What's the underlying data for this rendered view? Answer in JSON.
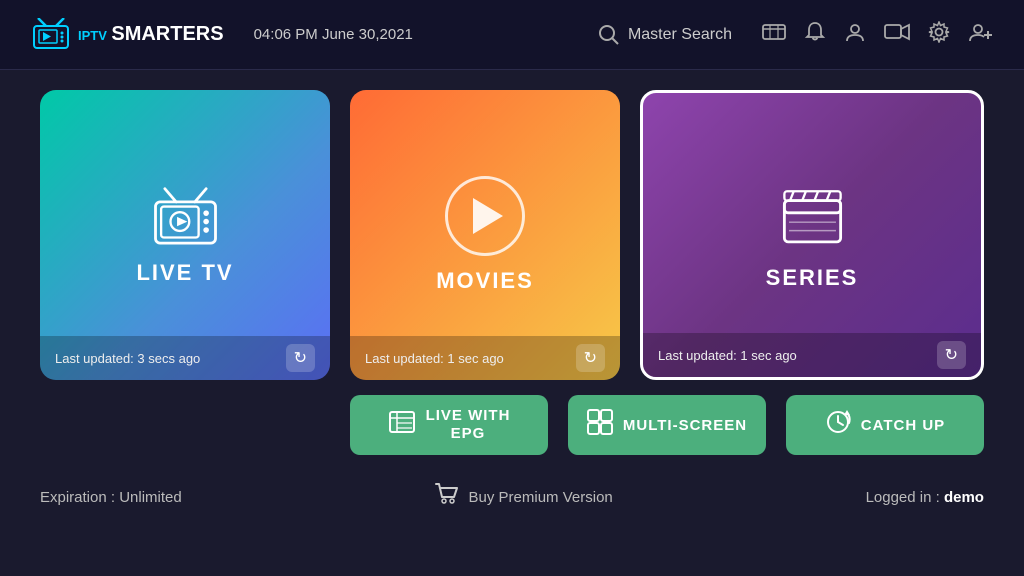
{
  "header": {
    "logo_iptv": "IPTV",
    "logo_smarters": "SMARTERS",
    "datetime": "04:06 PM   June 30,2021",
    "search_label": "Master Search"
  },
  "cards": {
    "live_tv": {
      "title": "LIVE TV",
      "last_updated": "Last updated: 3 secs ago"
    },
    "movies": {
      "title": "MOVIES",
      "last_updated": "Last updated: 1 sec ago"
    },
    "series": {
      "title": "SERIES",
      "last_updated": "Last updated: 1 sec ago"
    }
  },
  "buttons": {
    "live_epg": "LIVE WITH\nEPG",
    "multi_screen": "MULTI-SCREEN",
    "catch_up": "CATCH UP"
  },
  "footer": {
    "expiration": "Expiration : Unlimited",
    "buy_premium": "Buy Premium Version",
    "logged_in_label": "Logged in : ",
    "logged_in_user": "demo"
  }
}
